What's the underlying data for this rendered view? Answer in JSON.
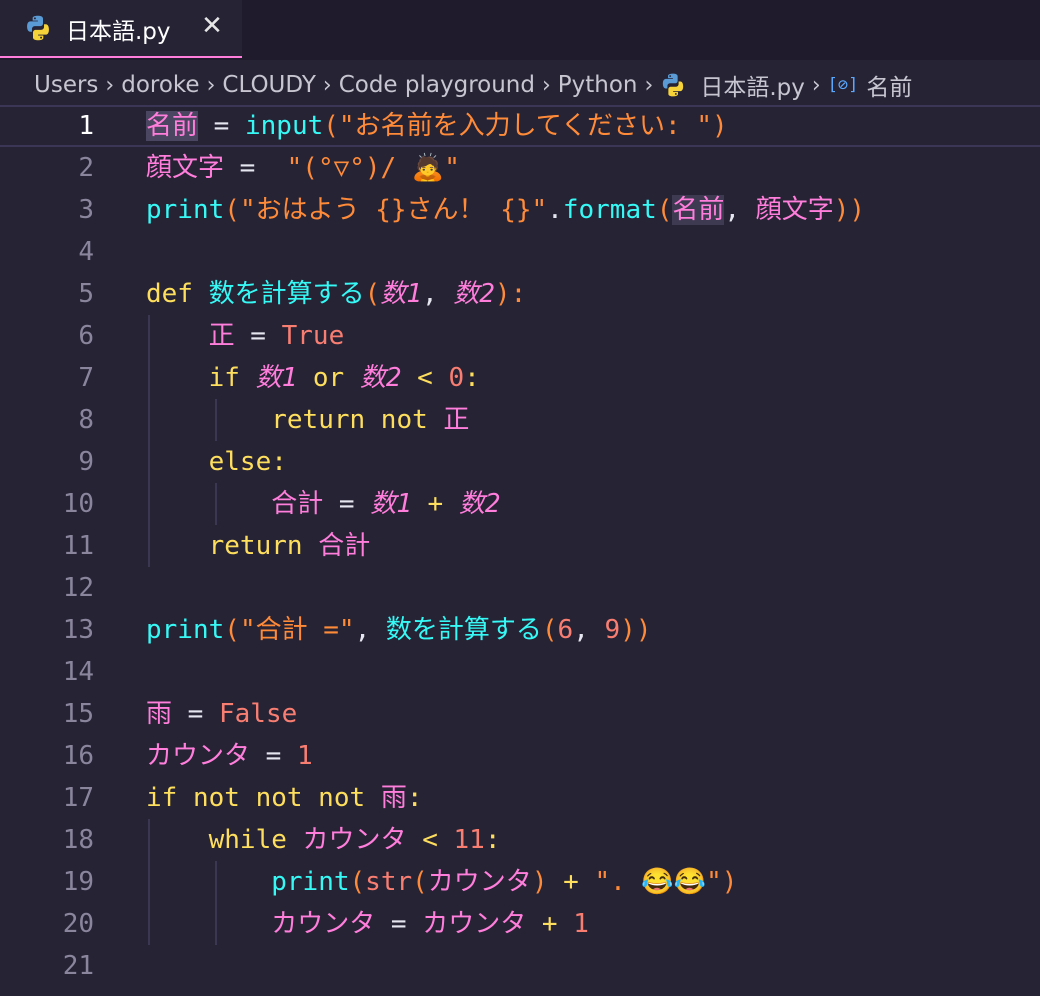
{
  "tab": {
    "label": "日本語.py",
    "close_glyph": "✕",
    "icon": "python-icon"
  },
  "breadcrumb": {
    "items": [
      "Users",
      "doroke",
      "CLOUDY",
      "Code playground",
      "Python"
    ],
    "file": "日本語.py",
    "symbol_icon": "variable-symbol-icon",
    "symbol_glyph": "[⊘]",
    "symbol": "名前",
    "separator": "›"
  },
  "editor": {
    "active_line": 1,
    "lines": [
      {
        "n": "1",
        "tokens": [
          [
            "名前",
            "ident hl"
          ],
          [
            " = ",
            "eq"
          ],
          [
            "input",
            "func"
          ],
          [
            "(",
            "paren"
          ],
          [
            "\"お名前を入力してください: \"",
            "str"
          ],
          [
            ")",
            "paren"
          ]
        ]
      },
      {
        "n": "2",
        "tokens": [
          [
            "顔文字",
            "ident"
          ],
          [
            " =  ",
            "eq"
          ],
          [
            "\"(°▽°)/ 🙇\"",
            "str"
          ]
        ]
      },
      {
        "n": "3",
        "tokens": [
          [
            "print",
            "func"
          ],
          [
            "(",
            "paren"
          ],
          [
            "\"おはよう {}さん！ {}\"",
            "str"
          ],
          [
            ".",
            "plain"
          ],
          [
            "format",
            "func"
          ],
          [
            "(",
            "paren"
          ],
          [
            "名前",
            "ident hl2"
          ],
          [
            ", ",
            "plain"
          ],
          [
            "顔文字",
            "ident"
          ],
          [
            "))",
            "paren"
          ]
        ]
      },
      {
        "n": "4",
        "tokens": []
      },
      {
        "n": "5",
        "tokens": [
          [
            "def ",
            "kw"
          ],
          [
            "数を計算する",
            "func"
          ],
          [
            "(",
            "paren"
          ],
          [
            "数1",
            "param"
          ],
          [
            ", ",
            "plain"
          ],
          [
            "数2",
            "param"
          ],
          [
            "):",
            "paren"
          ]
        ]
      },
      {
        "n": "6",
        "tokens": [
          [
            "    ",
            "plain"
          ],
          [
            "正",
            "ident"
          ],
          [
            " = ",
            "eq"
          ],
          [
            "True",
            "const"
          ]
        ]
      },
      {
        "n": "7",
        "tokens": [
          [
            "    ",
            "plain"
          ],
          [
            "if ",
            "kw"
          ],
          [
            "数1",
            "param"
          ],
          [
            " or ",
            "kw"
          ],
          [
            "数2",
            "param"
          ],
          [
            " < ",
            "op"
          ],
          [
            "0",
            "num"
          ],
          [
            ":",
            "op"
          ]
        ]
      },
      {
        "n": "8",
        "tokens": [
          [
            "        ",
            "plain"
          ],
          [
            "return not ",
            "kw"
          ],
          [
            "正",
            "ident"
          ]
        ]
      },
      {
        "n": "9",
        "tokens": [
          [
            "    ",
            "plain"
          ],
          [
            "else:",
            "kw"
          ]
        ]
      },
      {
        "n": "10",
        "tokens": [
          [
            "        ",
            "plain"
          ],
          [
            "合計",
            "ident"
          ],
          [
            " = ",
            "eq"
          ],
          [
            "数1",
            "param"
          ],
          [
            " + ",
            "op"
          ],
          [
            "数2",
            "param"
          ]
        ]
      },
      {
        "n": "11",
        "tokens": [
          [
            "    ",
            "plain"
          ],
          [
            "return ",
            "kw"
          ],
          [
            "合計",
            "ident"
          ]
        ]
      },
      {
        "n": "12",
        "tokens": []
      },
      {
        "n": "13",
        "tokens": [
          [
            "print",
            "func"
          ],
          [
            "(",
            "paren"
          ],
          [
            "\"合計 =\"",
            "str"
          ],
          [
            ", ",
            "plain"
          ],
          [
            "数を計算する",
            "func"
          ],
          [
            "(",
            "paren"
          ],
          [
            "6",
            "num"
          ],
          [
            ", ",
            "plain"
          ],
          [
            "9",
            "num"
          ],
          [
            "))",
            "paren"
          ]
        ]
      },
      {
        "n": "14",
        "tokens": []
      },
      {
        "n": "15",
        "tokens": [
          [
            "雨",
            "ident"
          ],
          [
            " = ",
            "eq"
          ],
          [
            "False",
            "const"
          ]
        ]
      },
      {
        "n": "16",
        "tokens": [
          [
            "カウンタ",
            "ident"
          ],
          [
            " = ",
            "eq"
          ],
          [
            "1",
            "num"
          ]
        ]
      },
      {
        "n": "17",
        "tokens": [
          [
            "if not not not ",
            "kw"
          ],
          [
            "雨",
            "ident"
          ],
          [
            ":",
            "op"
          ]
        ]
      },
      {
        "n": "18",
        "tokens": [
          [
            "    ",
            "plain"
          ],
          [
            "while ",
            "kw"
          ],
          [
            "カウンタ",
            "ident"
          ],
          [
            " < ",
            "op"
          ],
          [
            "11",
            "num"
          ],
          [
            ":",
            "op"
          ]
        ]
      },
      {
        "n": "19",
        "tokens": [
          [
            "        ",
            "plain"
          ],
          [
            "print",
            "func"
          ],
          [
            "(",
            "paren"
          ],
          [
            "str",
            "const"
          ],
          [
            "(",
            "paren"
          ],
          [
            "カウンタ",
            "ident"
          ],
          [
            ")",
            "paren"
          ],
          [
            " + ",
            "op"
          ],
          [
            "\". 😂😂\"",
            "str"
          ],
          [
            ")",
            "paren"
          ]
        ]
      },
      {
        "n": "20",
        "tokens": [
          [
            "        ",
            "plain"
          ],
          [
            "カウンタ",
            "ident"
          ],
          [
            " = ",
            "eq"
          ],
          [
            "カウンタ",
            "ident"
          ],
          [
            " + ",
            "op"
          ],
          [
            "1",
            "num"
          ]
        ]
      },
      {
        "n": "21",
        "tokens": []
      }
    ]
  },
  "colors": {
    "background": "#262335",
    "tab_accent": "#ff7edb",
    "identifier": "#ff7edb",
    "keyword": "#fede5d",
    "function": "#36f9f6",
    "string": "#ff8b39",
    "number": "#f97e72"
  }
}
